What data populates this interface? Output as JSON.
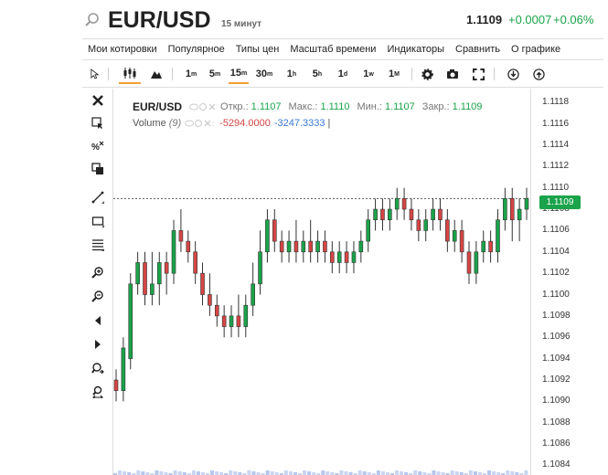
{
  "header": {
    "symbol": "EUR/USD",
    "timeframe": "15 минут",
    "last": "1.1109",
    "change": "+0.0007",
    "change_pct": "+0.06%"
  },
  "menu": [
    "Мои котировки",
    "Популярное",
    "Типы цен",
    "Масштаб времени",
    "Индикаторы",
    "Сравнить",
    "О графике"
  ],
  "toolbar": {
    "intervals": [
      {
        "base": "1",
        "unit": "m"
      },
      {
        "base": "5",
        "unit": "m"
      },
      {
        "base": "15",
        "unit": "m"
      },
      {
        "base": "30",
        "unit": "m"
      },
      {
        "base": "1",
        "unit": "h"
      },
      {
        "base": "5",
        "unit": "h"
      },
      {
        "base": "1",
        "unit": "d"
      },
      {
        "base": "1",
        "unit": "w"
      },
      {
        "base": "1",
        "unit": "M"
      }
    ],
    "active_interval": "15m"
  },
  "legend": {
    "symbol": "EUR/USD",
    "open_label": "Откр.:",
    "open": "1.1107",
    "high_label": "Макс.:",
    "high": "1.1110",
    "low_label": "Мин.:",
    "low": "1.1107",
    "close_label": "Закр.:",
    "close": "1.1109",
    "volume_name": "Volume",
    "volume_param": "(9)",
    "volume_val1": "-5294.0000",
    "volume_val2": "-3247.3333",
    "cursor": "|"
  },
  "price_axis": {
    "ticks": [
      "1.1118",
      "1.1116",
      "1.1114",
      "1.1112",
      "1.1110",
      "1.1108",
      "1.1106",
      "1.1104",
      "1.1102",
      "1.1100",
      "1.1098",
      "1.1096",
      "1.1094",
      "1.1092",
      "1.1090",
      "1.1088",
      "1.1086",
      "1.1084"
    ],
    "current_price": "1.1109"
  },
  "colors": {
    "up": "#1aa34a",
    "down": "#d64545",
    "accent": "#f0a030"
  },
  "chart_data": {
    "type": "candlestick",
    "ylim": [
      1.10831,
      1.11193
    ],
    "last_price": 1.1109,
    "candles": [
      [
        1.1092,
        1.1093,
        1.109,
        1.1091
      ],
      [
        1.1091,
        1.1096,
        1.109,
        1.1095
      ],
      [
        1.1094,
        1.1102,
        1.1093,
        1.1101
      ],
      [
        1.1101,
        1.1104,
        1.11,
        1.1103
      ],
      [
        1.1103,
        1.1104,
        1.1099,
        1.11
      ],
      [
        1.11,
        1.1104,
        1.1099,
        1.1101
      ],
      [
        1.1101,
        1.1104,
        1.1099,
        1.1103
      ],
      [
        1.1103,
        1.1104,
        1.11,
        1.1102
      ],
      [
        1.1102,
        1.1107,
        1.1101,
        1.1106
      ],
      [
        1.1106,
        1.1108,
        1.1104,
        1.1105
      ],
      [
        1.1105,
        1.1106,
        1.1103,
        1.1104
      ],
      [
        1.1104,
        1.1105,
        1.1101,
        1.1102
      ],
      [
        1.1102,
        1.1103,
        1.1099,
        1.11
      ],
      [
        1.11,
        1.1102,
        1.1098,
        1.1099
      ],
      [
        1.1099,
        1.11,
        1.1097,
        1.1098
      ],
      [
        1.1098,
        1.1099,
        1.1096,
        1.1097
      ],
      [
        1.1097,
        1.1099,
        1.1096,
        1.1098
      ],
      [
        1.1098,
        1.11,
        1.1096,
        1.1097
      ],
      [
        1.1097,
        1.11,
        1.1096,
        1.1099
      ],
      [
        1.1099,
        1.1103,
        1.1098,
        1.1101
      ],
      [
        1.1101,
        1.1106,
        1.11,
        1.1104
      ],
      [
        1.1104,
        1.1108,
        1.1103,
        1.1107
      ],
      [
        1.1107,
        1.1108,
        1.1104,
        1.1105
      ],
      [
        1.1105,
        1.1106,
        1.1103,
        1.1104
      ],
      [
        1.1104,
        1.1106,
        1.1103,
        1.1105
      ],
      [
        1.1105,
        1.1107,
        1.1103,
        1.1104
      ],
      [
        1.1104,
        1.1106,
        1.1103,
        1.1105
      ],
      [
        1.1105,
        1.1107,
        1.1103,
        1.1104
      ],
      [
        1.1104,
        1.1106,
        1.1103,
        1.1105
      ],
      [
        1.1105,
        1.1106,
        1.1103,
        1.1104
      ],
      [
        1.1104,
        1.1105,
        1.1102,
        1.1103
      ],
      [
        1.1103,
        1.1105,
        1.1102,
        1.1104
      ],
      [
        1.1104,
        1.1105,
        1.1102,
        1.1103
      ],
      [
        1.1103,
        1.1105,
        1.1102,
        1.1104
      ],
      [
        1.1104,
        1.1106,
        1.1103,
        1.1105
      ],
      [
        1.1105,
        1.1108,
        1.1104,
        1.1107
      ],
      [
        1.1107,
        1.1109,
        1.1106,
        1.1108
      ],
      [
        1.1108,
        1.1109,
        1.1106,
        1.1107
      ],
      [
        1.1107,
        1.1109,
        1.1106,
        1.1108
      ],
      [
        1.1108,
        1.111,
        1.1107,
        1.1109
      ],
      [
        1.1109,
        1.111,
        1.1107,
        1.1108
      ],
      [
        1.1108,
        1.1109,
        1.1106,
        1.1107
      ],
      [
        1.1107,
        1.1108,
        1.1105,
        1.1106
      ],
      [
        1.1106,
        1.1108,
        1.1105,
        1.1107
      ],
      [
        1.1107,
        1.1109,
        1.1106,
        1.1108
      ],
      [
        1.1108,
        1.1109,
        1.1106,
        1.1107
      ],
      [
        1.1107,
        1.1108,
        1.1104,
        1.1105
      ],
      [
        1.1105,
        1.1107,
        1.1104,
        1.1106
      ],
      [
        1.1106,
        1.1107,
        1.1103,
        1.1104
      ],
      [
        1.1104,
        1.1105,
        1.1101,
        1.1102
      ],
      [
        1.1102,
        1.1105,
        1.1101,
        1.1104
      ],
      [
        1.1104,
        1.1106,
        1.1103,
        1.1105
      ],
      [
        1.1105,
        1.1106,
        1.1103,
        1.1104
      ],
      [
        1.1104,
        1.1108,
        1.1103,
        1.1107
      ],
      [
        1.1107,
        1.111,
        1.1106,
        1.1109
      ],
      [
        1.1109,
        1.111,
        1.1105,
        1.1107
      ],
      [
        1.1107,
        1.1109,
        1.1105,
        1.1108
      ],
      [
        1.1108,
        1.111,
        1.1107,
        1.1109
      ]
    ]
  }
}
